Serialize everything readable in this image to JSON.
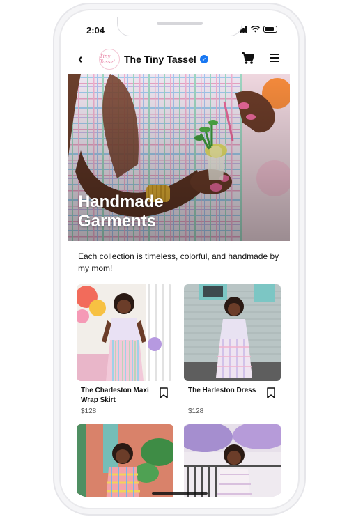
{
  "status_bar": {
    "time": "2:04"
  },
  "navbar": {
    "store_name": "The Tiny Tassel",
    "logo_text": "Tiny Tassel"
  },
  "hero": {
    "title": "Handmade Garments"
  },
  "description": "Each collection is timeless, colorful, and handmade by my mom!",
  "products": [
    {
      "name": "The Charleston Maxi Wrap Skirt",
      "price": "$128"
    },
    {
      "name": "The Harleston Dress",
      "price": "$128"
    },
    {
      "name": "",
      "price": ""
    },
    {
      "name": "",
      "price": ""
    }
  ],
  "colors": {
    "verified_badge": "#1877f2",
    "accent_pink": "#e8689a"
  },
  "icons": [
    "back-arrow-icon",
    "verified-icon",
    "cart-icon",
    "menu-icon",
    "bookmark-icon"
  ]
}
